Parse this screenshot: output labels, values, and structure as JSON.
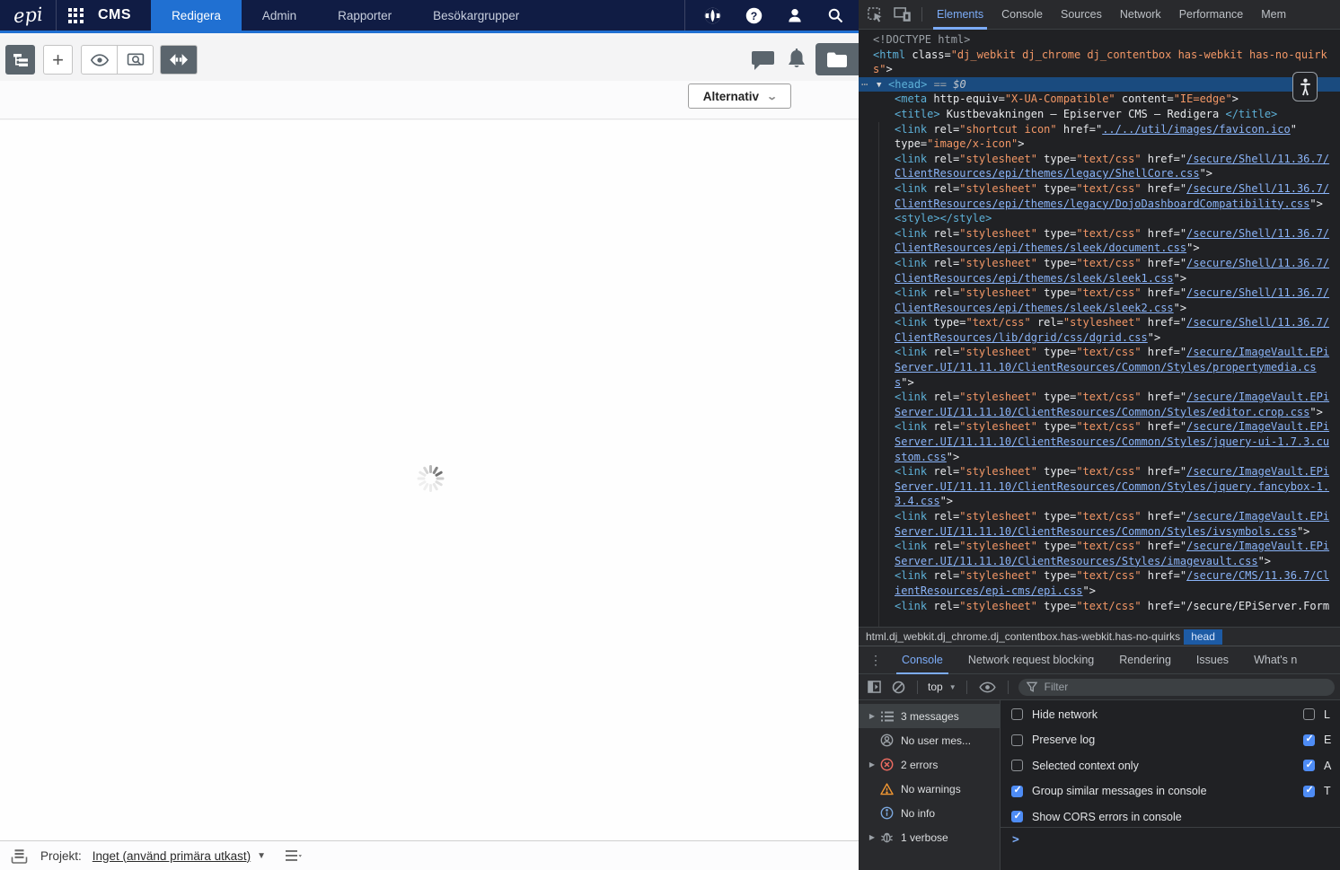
{
  "app": {
    "brand": "epi",
    "product": "CMS",
    "nav_tabs": [
      {
        "label": "Redigera",
        "active": true
      },
      {
        "label": "Admin",
        "active": false
      },
      {
        "label": "Rapporter",
        "active": false
      },
      {
        "label": "Besökargrupper",
        "active": false
      }
    ],
    "options_button": "Alternativ",
    "project_bar": {
      "label": "Projekt:",
      "value": "Inget (använd primära utkast)"
    },
    "colors": {
      "navbar": "#101c44",
      "accent_blue": "#2070d2",
      "toolbar_button": "#5b656d"
    }
  },
  "devtools": {
    "main_tabs": [
      {
        "label": "Elements",
        "active": true
      },
      {
        "label": "Console",
        "active": false
      },
      {
        "label": "Sources",
        "active": false
      },
      {
        "label": "Network",
        "active": false
      },
      {
        "label": "Performance",
        "active": false
      },
      {
        "label": "Mem",
        "active": false
      }
    ],
    "breadcrumb": {
      "path": "html.dj_webkit.dj_chrome.dj_contentbox.has-webkit.has-no-quirks",
      "selected": "head"
    },
    "drawer_tabs": [
      {
        "label": "Console",
        "active": true
      },
      {
        "label": "Network request blocking",
        "active": false
      },
      {
        "label": "Rendering",
        "active": false
      },
      {
        "label": "Issues",
        "active": false
      },
      {
        "label": "What's n",
        "active": false
      }
    ],
    "console_toolbar": {
      "context": "top",
      "filter_placeholder": "Filter"
    },
    "console_sidebar": [
      {
        "icon": "list-icon",
        "label": "3 messages",
        "selected": true,
        "expandable": true
      },
      {
        "icon": "user-icon",
        "label": "No user mes...",
        "selected": false,
        "expandable": false
      },
      {
        "icon": "error-icon",
        "label": "2 errors",
        "selected": false,
        "expandable": true
      },
      {
        "icon": "warning-icon",
        "label": "No warnings",
        "selected": false,
        "expandable": false
      },
      {
        "icon": "info-icon",
        "label": "No info",
        "selected": false,
        "expandable": false
      },
      {
        "icon": "verbose-icon",
        "label": "1 verbose",
        "selected": false,
        "expandable": true
      }
    ],
    "console_settings_left": [
      {
        "label": "Hide network",
        "checked": false
      },
      {
        "label": "Preserve log",
        "checked": false
      },
      {
        "label": "Selected context only",
        "checked": false
      },
      {
        "label": "Group similar messages in console",
        "checked": true
      },
      {
        "label": "Show CORS errors in console",
        "checked": true
      }
    ],
    "console_settings_right": [
      {
        "label": "L",
        "checked": false
      },
      {
        "label": "E",
        "checked": true
      },
      {
        "label": "A",
        "checked": true
      },
      {
        "label": "T",
        "checked": true
      }
    ],
    "prompt": ">",
    "dom_lines": [
      {
        "ind": 0,
        "seg": [
          [
            "g",
            "<!DOCTYPE html>"
          ]
        ]
      },
      {
        "ind": 0,
        "seg": [
          [
            "t",
            "<html"
          ],
          [
            "p",
            " class="
          ],
          [
            "v",
            "\"dj_webkit dj_chrome dj_contentbox has-webkit has-no-quirk"
          ]
        ]
      },
      {
        "ind": 0,
        "seg": [
          [
            "v",
            "s\""
          ],
          [
            "p",
            ">"
          ]
        ]
      },
      {
        "ind": 1,
        "sel": true,
        "seg": [
          [
            "t",
            "<head>"
          ],
          [
            "g",
            " == "
          ],
          [
            "d",
            "$0"
          ]
        ]
      },
      {
        "ind": 2,
        "seg": [
          [
            "t",
            "<meta"
          ],
          [
            "p",
            " http-equiv="
          ],
          [
            "v",
            "\"X-UA-Compatible\""
          ],
          [
            "p",
            " content="
          ],
          [
            "v",
            "\"IE=edge\""
          ],
          [
            "p",
            ">"
          ]
        ]
      },
      {
        "ind": 2,
        "seg": [
          [
            "t",
            "<title>"
          ],
          [
            "p",
            " Kustbevakningen – Episerver CMS – Redigera "
          ],
          [
            "t",
            "</title>"
          ]
        ]
      },
      {
        "ind": 2,
        "seg": [
          [
            "t",
            "<link"
          ],
          [
            "p",
            " rel="
          ],
          [
            "v",
            "\"shortcut icon\""
          ],
          [
            "p",
            " href=\""
          ],
          [
            "u",
            "../../util/images/favicon.ico"
          ],
          [
            "p",
            "\""
          ]
        ]
      },
      {
        "ind": 2,
        "seg": [
          [
            "p",
            "type="
          ],
          [
            "v",
            "\"image/x-icon\""
          ],
          [
            "p",
            ">"
          ]
        ]
      },
      {
        "ind": 2,
        "seg": [
          [
            "t",
            "<link"
          ],
          [
            "p",
            " rel="
          ],
          [
            "v",
            "\"stylesheet\""
          ],
          [
            "p",
            " type="
          ],
          [
            "v",
            "\"text/css\""
          ],
          [
            "p",
            " href=\""
          ],
          [
            "u",
            "/secure/Shell/11.36.7/"
          ]
        ]
      },
      {
        "ind": 2,
        "seg": [
          [
            "u",
            "ClientResources/epi/themes/legacy/ShellCore.css"
          ],
          [
            "p",
            "\">"
          ]
        ]
      },
      {
        "ind": 2,
        "seg": [
          [
            "t",
            "<link"
          ],
          [
            "p",
            " rel="
          ],
          [
            "v",
            "\"stylesheet\""
          ],
          [
            "p",
            " type="
          ],
          [
            "v",
            "\"text/css\""
          ],
          [
            "p",
            " href=\""
          ],
          [
            "u",
            "/secure/Shell/11.36.7/"
          ]
        ]
      },
      {
        "ind": 2,
        "seg": [
          [
            "u",
            "ClientResources/epi/themes/legacy/DojoDashboardCompatibility.css"
          ],
          [
            "p",
            "\">"
          ]
        ]
      },
      {
        "ind": 2,
        "seg": [
          [
            "t",
            "<style></style>"
          ]
        ]
      },
      {
        "ind": 2,
        "seg": [
          [
            "t",
            "<link"
          ],
          [
            "p",
            " rel="
          ],
          [
            "v",
            "\"stylesheet\""
          ],
          [
            "p",
            " type="
          ],
          [
            "v",
            "\"text/css\""
          ],
          [
            "p",
            " href=\""
          ],
          [
            "u",
            "/secure/Shell/11.36.7/"
          ]
        ]
      },
      {
        "ind": 2,
        "seg": [
          [
            "u",
            "ClientResources/epi/themes/sleek/document.css"
          ],
          [
            "p",
            "\">"
          ]
        ]
      },
      {
        "ind": 2,
        "seg": [
          [
            "t",
            "<link"
          ],
          [
            "p",
            " rel="
          ],
          [
            "v",
            "\"stylesheet\""
          ],
          [
            "p",
            " type="
          ],
          [
            "v",
            "\"text/css\""
          ],
          [
            "p",
            " href=\""
          ],
          [
            "u",
            "/secure/Shell/11.36.7/"
          ]
        ]
      },
      {
        "ind": 2,
        "seg": [
          [
            "u",
            "ClientResources/epi/themes/sleek/sleek1.css"
          ],
          [
            "p",
            "\">"
          ]
        ]
      },
      {
        "ind": 2,
        "seg": [
          [
            "t",
            "<link"
          ],
          [
            "p",
            " rel="
          ],
          [
            "v",
            "\"stylesheet\""
          ],
          [
            "p",
            " type="
          ],
          [
            "v",
            "\"text/css\""
          ],
          [
            "p",
            " href=\""
          ],
          [
            "u",
            "/secure/Shell/11.36.7/"
          ]
        ]
      },
      {
        "ind": 2,
        "seg": [
          [
            "u",
            "ClientResources/epi/themes/sleek/sleek2.css"
          ],
          [
            "p",
            "\">"
          ]
        ]
      },
      {
        "ind": 2,
        "seg": [
          [
            "t",
            "<link"
          ],
          [
            "p",
            " type="
          ],
          [
            "v",
            "\"text/css\""
          ],
          [
            "p",
            " rel="
          ],
          [
            "v",
            "\"stylesheet\""
          ],
          [
            "p",
            " href=\""
          ],
          [
            "u",
            "/secure/Shell/11.36.7/"
          ]
        ]
      },
      {
        "ind": 2,
        "seg": [
          [
            "u",
            "ClientResources/lib/dgrid/css/dgrid.css"
          ],
          [
            "p",
            "\">"
          ]
        ]
      },
      {
        "ind": 2,
        "seg": [
          [
            "t",
            "<link"
          ],
          [
            "p",
            " rel="
          ],
          [
            "v",
            "\"stylesheet\""
          ],
          [
            "p",
            " type="
          ],
          [
            "v",
            "\"text/css\""
          ],
          [
            "p",
            " href=\""
          ],
          [
            "u",
            "/secure/ImageVault.EPi"
          ]
        ]
      },
      {
        "ind": 2,
        "seg": [
          [
            "u",
            "Server.UI/11.11.10/ClientResources/Common/Styles/propertymedia.cs"
          ]
        ]
      },
      {
        "ind": 2,
        "seg": [
          [
            "u",
            "s"
          ],
          [
            "p",
            "\">"
          ]
        ]
      },
      {
        "ind": 2,
        "seg": [
          [
            "t",
            "<link"
          ],
          [
            "p",
            " rel="
          ],
          [
            "v",
            "\"stylesheet\""
          ],
          [
            "p",
            " type="
          ],
          [
            "v",
            "\"text/css\""
          ],
          [
            "p",
            " href=\""
          ],
          [
            "u",
            "/secure/ImageVault.EPi"
          ]
        ]
      },
      {
        "ind": 2,
        "seg": [
          [
            "u",
            "Server.UI/11.11.10/ClientResources/Common/Styles/editor.crop.css"
          ],
          [
            "p",
            "\">"
          ]
        ]
      },
      {
        "ind": 2,
        "seg": [
          [
            "t",
            "<link"
          ],
          [
            "p",
            " rel="
          ],
          [
            "v",
            "\"stylesheet\""
          ],
          [
            "p",
            " type="
          ],
          [
            "v",
            "\"text/css\""
          ],
          [
            "p",
            " href=\""
          ],
          [
            "u",
            "/secure/ImageVault.EPi"
          ]
        ]
      },
      {
        "ind": 2,
        "seg": [
          [
            "u",
            "Server.UI/11.11.10/ClientResources/Common/Styles/jquery-ui-1.7.3.cu"
          ]
        ]
      },
      {
        "ind": 2,
        "seg": [
          [
            "u",
            "stom.css"
          ],
          [
            "p",
            "\">"
          ]
        ]
      },
      {
        "ind": 2,
        "seg": [
          [
            "t",
            "<link"
          ],
          [
            "p",
            " rel="
          ],
          [
            "v",
            "\"stylesheet\""
          ],
          [
            "p",
            " type="
          ],
          [
            "v",
            "\"text/css\""
          ],
          [
            "p",
            " href=\""
          ],
          [
            "u",
            "/secure/ImageVault.EPi"
          ]
        ]
      },
      {
        "ind": 2,
        "seg": [
          [
            "u",
            "Server.UI/11.11.10/ClientResources/Common/Styles/jquery.fancybox-1."
          ]
        ]
      },
      {
        "ind": 2,
        "seg": [
          [
            "u",
            "3.4.css"
          ],
          [
            "p",
            "\">"
          ]
        ]
      },
      {
        "ind": 2,
        "seg": [
          [
            "t",
            "<link"
          ],
          [
            "p",
            " rel="
          ],
          [
            "v",
            "\"stylesheet\""
          ],
          [
            "p",
            " type="
          ],
          [
            "v",
            "\"text/css\""
          ],
          [
            "p",
            " href=\""
          ],
          [
            "u",
            "/secure/ImageVault.EPi"
          ]
        ]
      },
      {
        "ind": 2,
        "seg": [
          [
            "u",
            "Server.UI/11.11.10/ClientResources/Common/Styles/ivsymbols.css"
          ],
          [
            "p",
            "\">"
          ]
        ]
      },
      {
        "ind": 2,
        "seg": [
          [
            "t",
            "<link"
          ],
          [
            "p",
            " rel="
          ],
          [
            "v",
            "\"stylesheet\""
          ],
          [
            "p",
            " type="
          ],
          [
            "v",
            "\"text/css\""
          ],
          [
            "p",
            " href=\""
          ],
          [
            "u",
            "/secure/ImageVault.EPi"
          ]
        ]
      },
      {
        "ind": 2,
        "seg": [
          [
            "u",
            "Server.UI/11.11.10/ClientResources/Styles/imagevault.css"
          ],
          [
            "p",
            "\">"
          ]
        ]
      },
      {
        "ind": 2,
        "seg": [
          [
            "t",
            "<link"
          ],
          [
            "p",
            " rel="
          ],
          [
            "v",
            "\"stylesheet\""
          ],
          [
            "p",
            " type="
          ],
          [
            "v",
            "\"text/css\""
          ],
          [
            "p",
            " href=\""
          ],
          [
            "u",
            "/secure/CMS/11.36.7/Cl"
          ]
        ]
      },
      {
        "ind": 2,
        "seg": [
          [
            "u",
            "ientResources/epi-cms/epi.css"
          ],
          [
            "p",
            "\">"
          ]
        ]
      },
      {
        "ind": 2,
        "seg": [
          [
            "t",
            "<link"
          ],
          [
            "p",
            " rel="
          ],
          [
            "v",
            "\"stylesheet\""
          ],
          [
            "p",
            " type="
          ],
          [
            "v",
            "\"text/css\""
          ],
          [
            "p",
            " href=\"/secure/EPiServer.Form"
          ]
        ]
      }
    ]
  }
}
